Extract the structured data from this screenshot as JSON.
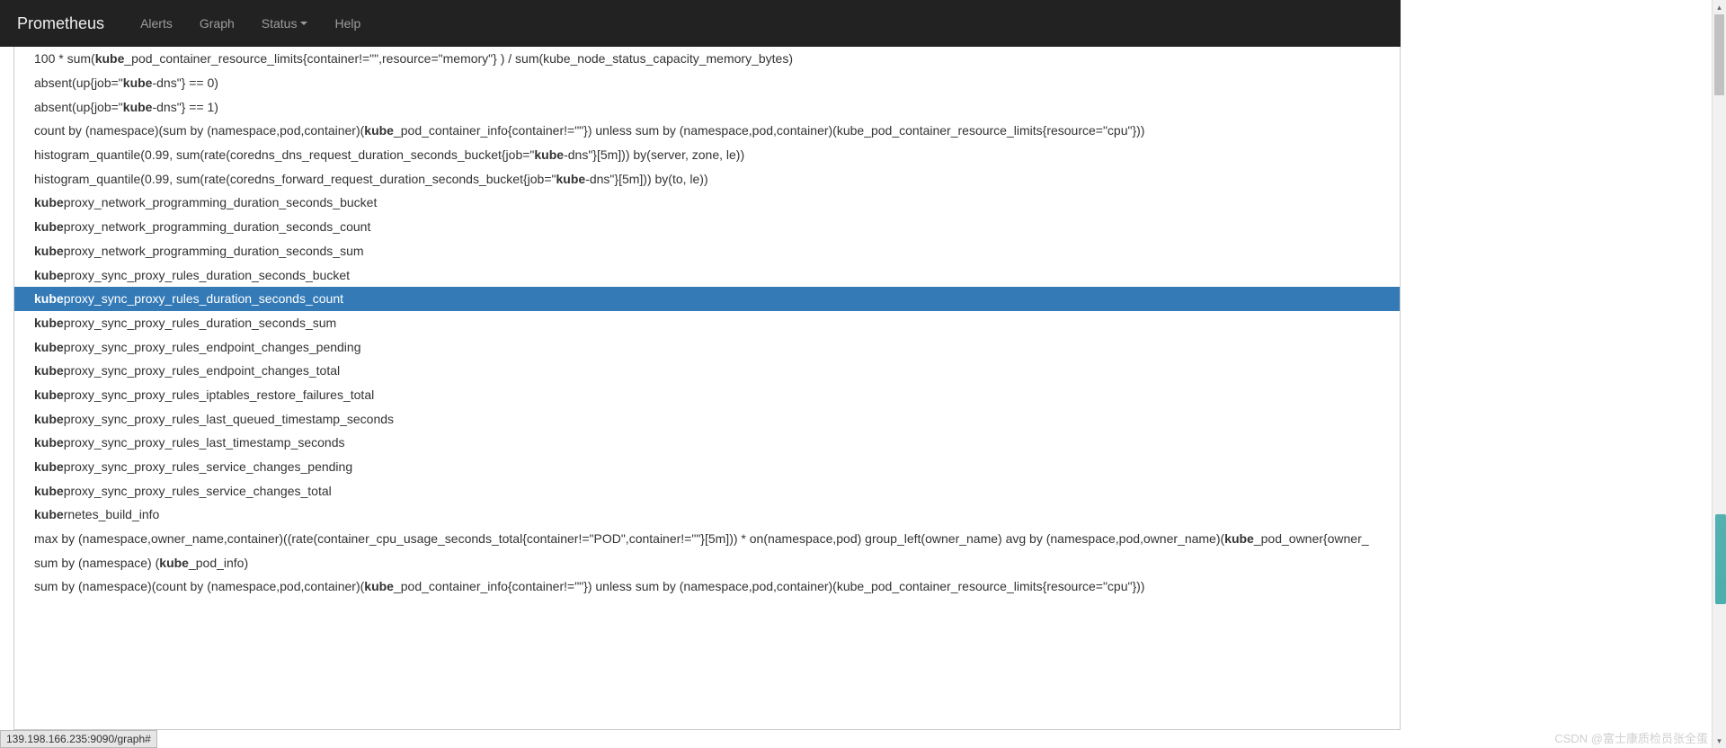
{
  "navbar": {
    "brand": "Prometheus",
    "items": [
      {
        "label": "Alerts"
      },
      {
        "label": "Graph"
      },
      {
        "label": "Status",
        "dropdown": true
      },
      {
        "label": "Help"
      }
    ]
  },
  "match_token": "kube",
  "autocomplete": [
    {
      "pre": "100 * sum(",
      "b": "kube",
      "post": "_pod_container_resource_limits{container!=\"\",resource=\"memory\"} ) / sum(kube_node_status_capacity_memory_bytes)"
    },
    {
      "pre": "absent(up{job=\"",
      "b": "kube",
      "post": "-dns\"} == 0)"
    },
    {
      "pre": "absent(up{job=\"",
      "b": "kube",
      "post": "-dns\"} == 1)"
    },
    {
      "pre": "count by (namespace)(sum by (namespace,pod,container)(",
      "b": "kube",
      "post": "_pod_container_info{container!=\"\"}) unless sum by (namespace,pod,container)(kube_pod_container_resource_limits{resource=\"cpu\"}))"
    },
    {
      "pre": "histogram_quantile(0.99, sum(rate(coredns_dns_request_duration_seconds_bucket{job=\"",
      "b": "kube",
      "post": "-dns\"}[5m])) by(server, zone, le))"
    },
    {
      "pre": "histogram_quantile(0.99, sum(rate(coredns_forward_request_duration_seconds_bucket{job=\"",
      "b": "kube",
      "post": "-dns\"}[5m])) by(to, le))"
    },
    {
      "pre": "",
      "b": "kube",
      "post": "proxy_network_programming_duration_seconds_bucket"
    },
    {
      "pre": "",
      "b": "kube",
      "post": "proxy_network_programming_duration_seconds_count"
    },
    {
      "pre": "",
      "b": "kube",
      "post": "proxy_network_programming_duration_seconds_sum"
    },
    {
      "pre": "",
      "b": "kube",
      "post": "proxy_sync_proxy_rules_duration_seconds_bucket"
    },
    {
      "pre": "",
      "b": "kube",
      "post": "proxy_sync_proxy_rules_duration_seconds_count",
      "active": true
    },
    {
      "pre": "",
      "b": "kube",
      "post": "proxy_sync_proxy_rules_duration_seconds_sum"
    },
    {
      "pre": "",
      "b": "kube",
      "post": "proxy_sync_proxy_rules_endpoint_changes_pending"
    },
    {
      "pre": "",
      "b": "kube",
      "post": "proxy_sync_proxy_rules_endpoint_changes_total"
    },
    {
      "pre": "",
      "b": "kube",
      "post": "proxy_sync_proxy_rules_iptables_restore_failures_total"
    },
    {
      "pre": "",
      "b": "kube",
      "post": "proxy_sync_proxy_rules_last_queued_timestamp_seconds"
    },
    {
      "pre": "",
      "b": "kube",
      "post": "proxy_sync_proxy_rules_last_timestamp_seconds"
    },
    {
      "pre": "",
      "b": "kube",
      "post": "proxy_sync_proxy_rules_service_changes_pending"
    },
    {
      "pre": "",
      "b": "kube",
      "post": "proxy_sync_proxy_rules_service_changes_total"
    },
    {
      "pre": "",
      "b": "kube",
      "post": "rnetes_build_info"
    },
    {
      "pre": "max by (namespace,owner_name,container)((rate(container_cpu_usage_seconds_total{container!=\"POD\",container!=\"\"}[5m])) * on(namespace,pod) group_left(owner_name) avg by (namespace,pod,owner_name)(",
      "b": "kube",
      "post": "_pod_owner{owner_"
    },
    {
      "pre": "sum by (namespace) (",
      "b": "kube",
      "post": "_pod_info)"
    },
    {
      "pre": "sum by (namespace)(count by (namespace,pod,container)(",
      "b": "kube",
      "post": "_pod_container_info{container!=\"\"}) unless sum by (namespace,pod,container)(kube_pod_container_resource_limits{resource=\"cpu\"}))"
    }
  ],
  "statusbar": {
    "text": "139.198.166.235:9090/graph#"
  },
  "watermark": "CSDN @富士康质检员张全蛋"
}
